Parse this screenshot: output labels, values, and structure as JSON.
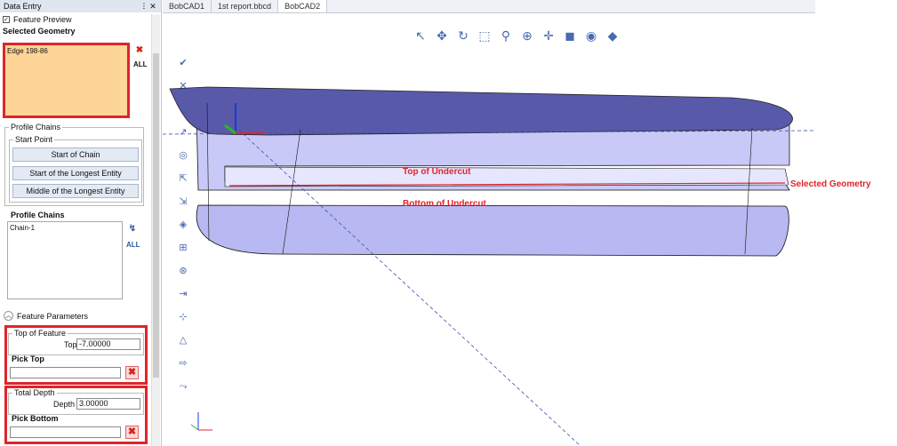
{
  "panel": {
    "title": "Data Entry",
    "pin_icon": "pin-icon",
    "feature_preview": "Feature Preview",
    "selected_geometry_title": "Selected Geometry",
    "selected_items": [
      "Edge 198-86"
    ],
    "profile_chains_group": "Profile Chains",
    "start_point_group": "Start Point",
    "buttons": [
      "Start of Chain",
      "Start of the Longest Entity",
      "Middle of the Longest Entity"
    ],
    "profile_chains_label": "Profile Chains",
    "chains": [
      "Chain-1"
    ],
    "feature_parameters": "Feature Parameters",
    "top_of_feature": "Top of Feature",
    "top_label": "Top",
    "top_value": "-7.00000",
    "pick_top": "Pick Top",
    "total_depth": "Total Depth",
    "depth_label": "Depth",
    "depth_value": "3.00000",
    "pick_bottom": "Pick Bottom"
  },
  "tabs": [
    "BobCAD1",
    "1st report.bbcd",
    "BobCAD2"
  ],
  "annotations": {
    "top_of_undercut": "Top of Undercut",
    "bottom_of_undercut": "Bottom of Undercut",
    "selected_geometry": "Selected Geometry"
  },
  "colors": {
    "highlight_red": "#e0242b",
    "part_top": "#5656a6",
    "part_side": "#b9b9f3",
    "selection_bg": "#fdd597"
  }
}
